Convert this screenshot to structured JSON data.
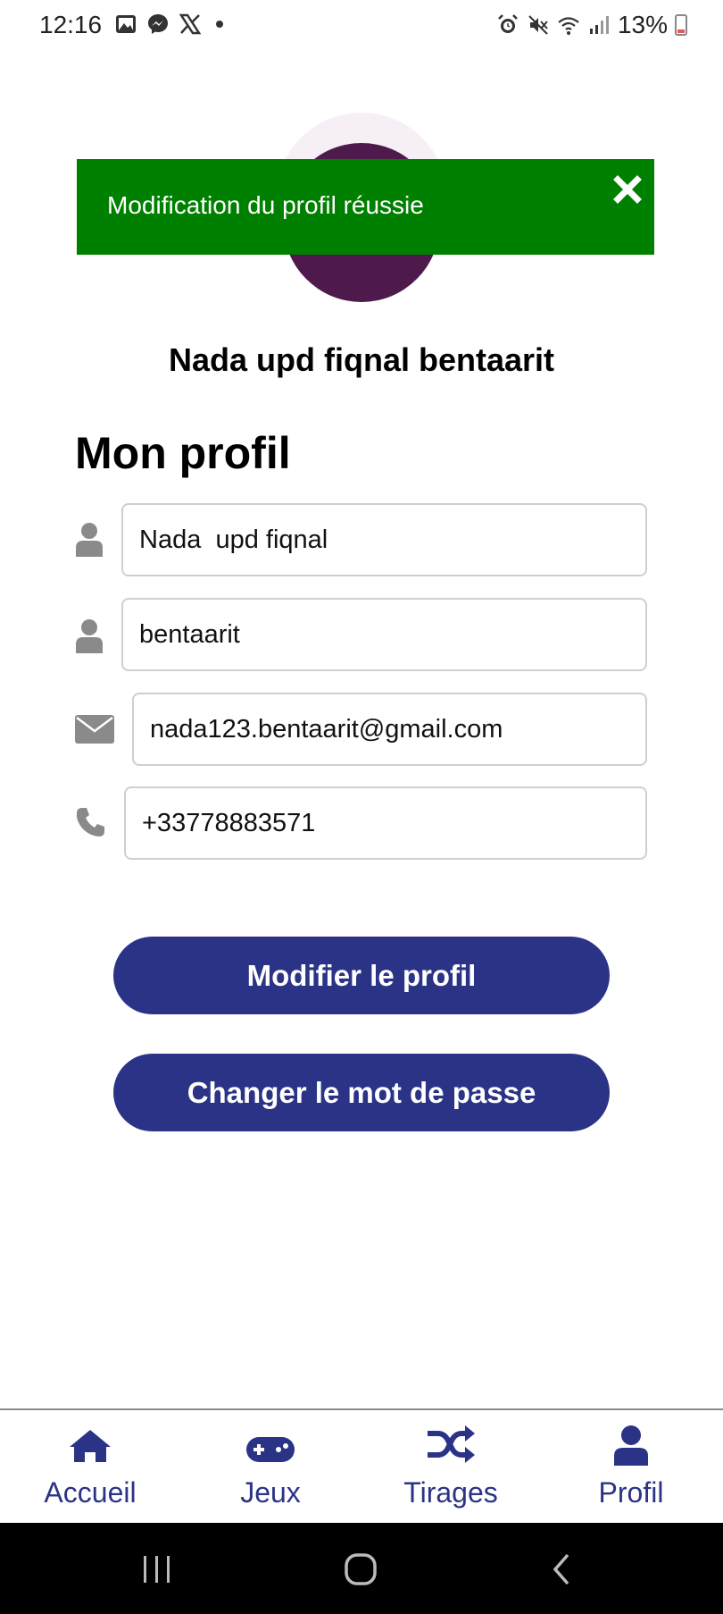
{
  "status_bar": {
    "time": "12:16",
    "battery": "13%",
    "left_icons": [
      "gallery-icon",
      "messenger-icon",
      "x-icon",
      "dot-icon"
    ],
    "right_icons": [
      "alarm-icon",
      "mute-icon",
      "wifi-icon",
      "signal-icon",
      "battery-icon"
    ]
  },
  "toast": {
    "message": "Modification du profil réussie",
    "color": "#008000"
  },
  "profile": {
    "full_name": "Nada  upd fiqnal bentaarit",
    "section_title": "Mon profil"
  },
  "form": {
    "first_name": "Nada  upd fiqnal",
    "last_name": "bentaarit",
    "email": "nada123.bentaarit@gmail.com",
    "phone": "+33778883571"
  },
  "buttons": {
    "edit_profile": "Modifier le profil",
    "change_password": "Changer le mot de passe"
  },
  "bottom_nav": {
    "items": [
      {
        "label": "Accueil",
        "icon": "home-icon"
      },
      {
        "label": "Jeux",
        "icon": "gamepad-icon"
      },
      {
        "label": "Tirages",
        "icon": "shuffle-icon"
      },
      {
        "label": "Profil",
        "icon": "user-icon"
      }
    ]
  },
  "colors": {
    "accent": "#2b3386",
    "success": "#008000",
    "avatar": "#4e1a4c"
  }
}
